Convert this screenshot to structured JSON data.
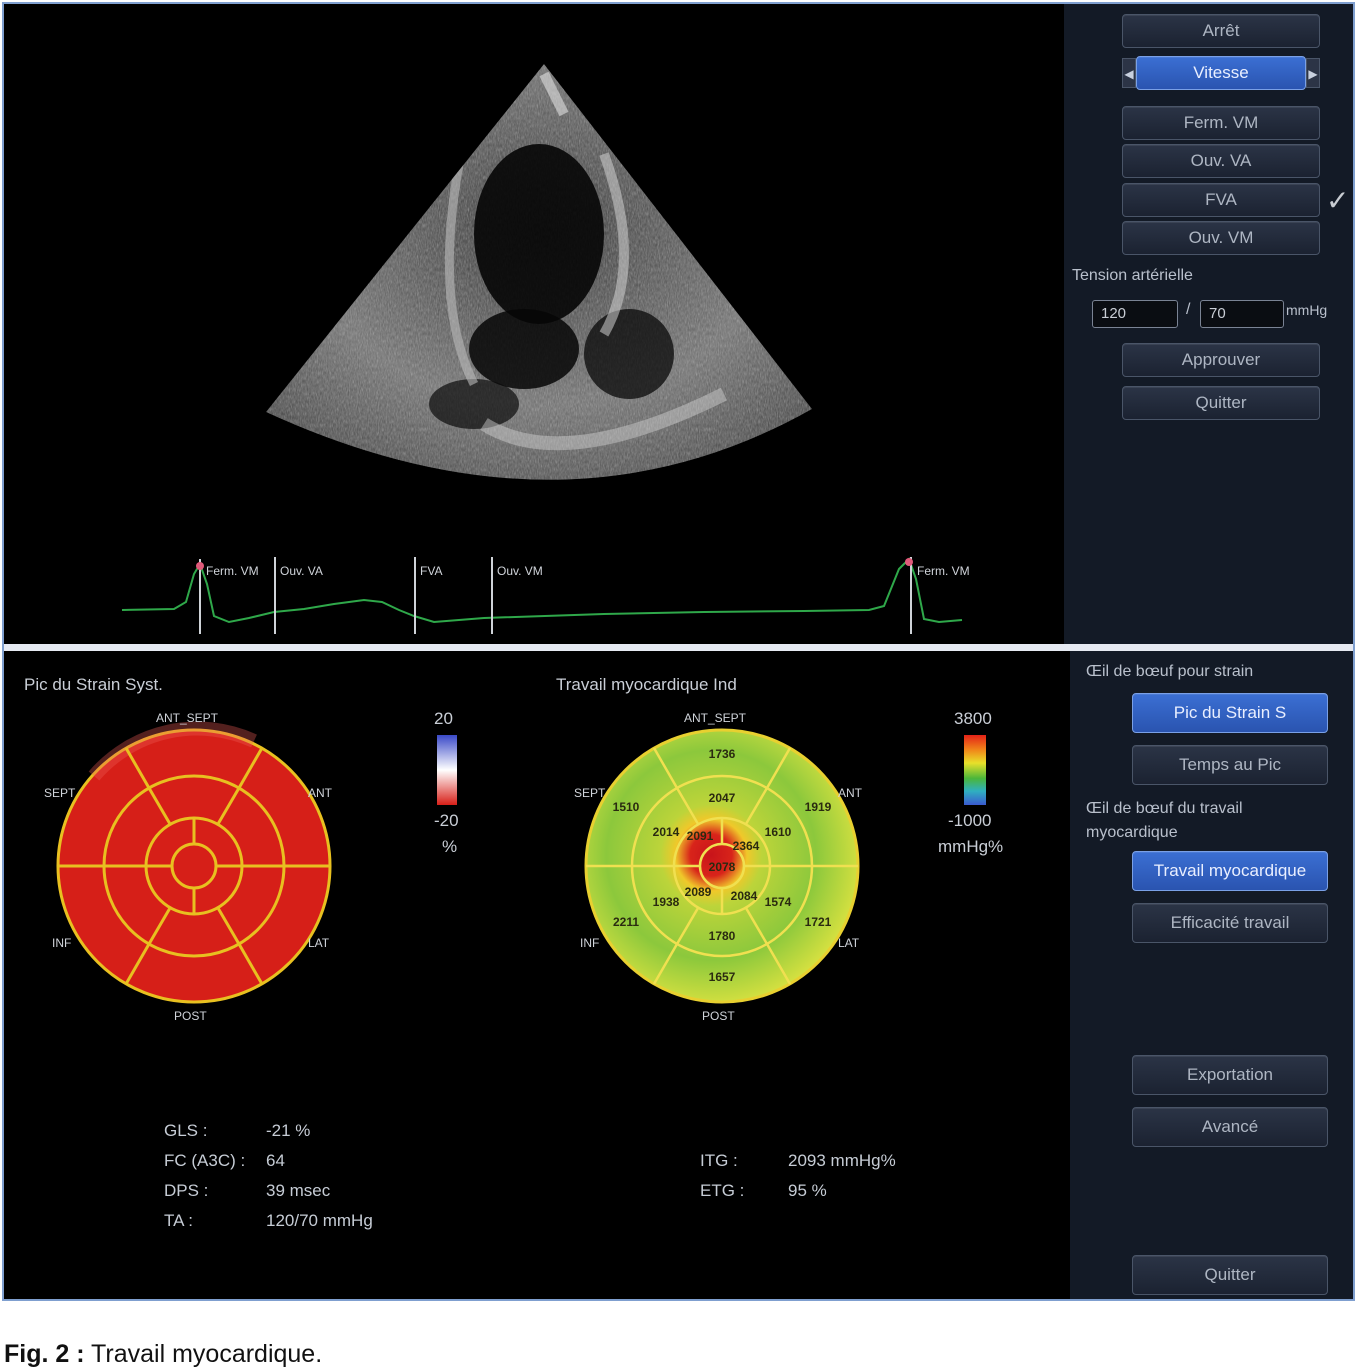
{
  "controls": {
    "stop": "Arrêt",
    "speed": "Vitesse",
    "events": [
      "Ferm. VM",
      "Ouv. VA",
      "FVA",
      "Ouv. VM"
    ],
    "check": "✓",
    "bp_label": "Tension artérielle",
    "bp_sys": "120",
    "bp_sep": "/",
    "bp_dia": "70",
    "bp_unit": "mmHg",
    "approve": "Approuver",
    "quit": "Quitter"
  },
  "ecg": {
    "markers": [
      "Ferm. VM",
      "Ouv. VA",
      "FVA",
      "Ouv. VM",
      "Ferm. VM"
    ]
  },
  "strain": {
    "title": "Pic du Strain Syst.",
    "labels": {
      "top": "ANT_SEPT",
      "left": "SEPT",
      "right": "ANT",
      "bottom_left": "INF",
      "bottom_right": "LAT",
      "bottom": "POST"
    },
    "scale_top": "20",
    "scale_bottom": "-20",
    "scale_unit": "%",
    "color": "#d81f18"
  },
  "work": {
    "title": "Travail myocardique Ind",
    "labels": {
      "top": "ANT_SEPT",
      "left": "SEPT",
      "right": "ANT",
      "bottom_left": "INF",
      "bottom_right": "LAT",
      "bottom": "POST"
    },
    "scale_top": "3800",
    "scale_bottom": "-1000",
    "scale_unit": "mmHg%",
    "segments": {
      "outer": [
        "1736",
        "1919",
        "1721",
        "1657",
        "2211",
        "1510"
      ],
      "mid": [
        "2047",
        "1610",
        "1574",
        "1780",
        "1938",
        "2014"
      ],
      "apex": [
        "2091",
        "2364",
        "2084",
        "2089"
      ],
      "center": "2078"
    }
  },
  "right_bottom": {
    "bullseye_strain_label": "Œil de bœuf pour strain",
    "peak_strain": "Pic du Strain S",
    "time_to_peak": "Temps au Pic",
    "bullseye_work_label": "Œil de bœuf du travail myocardique",
    "work": "Travail myocardique",
    "efficiency": "Efficacité travail",
    "export": "Exportation",
    "advanced": "Avancé",
    "quit": "Quitter"
  },
  "stats_left": [
    {
      "label": "GLS :",
      "value": "-21 %"
    },
    {
      "label": "FC (A3C) :",
      "value": "64"
    },
    {
      "label": "DPS :",
      "value": "39 msec"
    },
    {
      "label": "TA :",
      "value": "120/70 mmHg"
    }
  ],
  "stats_right": [
    {
      "label": "ITG :",
      "value": "2093 mmHg%"
    },
    {
      "label": "ETG :",
      "value": "95 %"
    }
  ],
  "caption": {
    "prefix": "Fig. 2 :",
    "text": " Travail myocardique."
  }
}
